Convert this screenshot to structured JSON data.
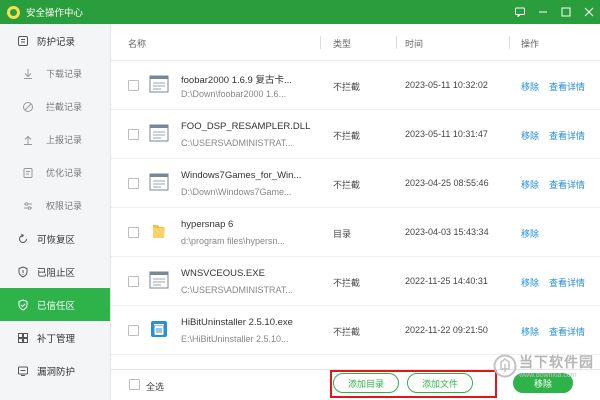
{
  "window": {
    "title": "安全操作中心"
  },
  "sidebar": {
    "items": [
      {
        "label": "防护记录",
        "icon": "shield-list-icon",
        "level": "top"
      },
      {
        "label": "下载记录",
        "icon": "download-icon",
        "level": "sub"
      },
      {
        "label": "拦截记录",
        "icon": "block-icon",
        "level": "sub"
      },
      {
        "label": "上报记录",
        "icon": "upload-icon",
        "level": "sub"
      },
      {
        "label": "优化记录",
        "icon": "optimize-icon",
        "level": "sub"
      },
      {
        "label": "权限记录",
        "icon": "permission-icon",
        "level": "sub"
      },
      {
        "label": "可恢复区",
        "icon": "restore-icon",
        "level": "top"
      },
      {
        "label": "已阻止区",
        "icon": "blocked-shield-icon",
        "level": "top"
      },
      {
        "label": "已信任区",
        "icon": "trusted-shield-icon",
        "level": "top",
        "active": true
      },
      {
        "label": "补丁管理",
        "icon": "patch-icon",
        "level": "top"
      },
      {
        "label": "漏洞防护",
        "icon": "vulnerability-icon",
        "level": "top"
      }
    ]
  },
  "table": {
    "headers": {
      "name": "名称",
      "type": "类型",
      "time": "时间",
      "action": "操作"
    },
    "rows": [
      {
        "name": "foobar2000  1.6.9 复古卡...",
        "path": "D:\\Down\\foobar2000  1.6...",
        "type": "不拦截",
        "time": "2023-05-11 10:32:02",
        "icon": "window-icon",
        "actions": [
          "移除",
          "查看详情"
        ]
      },
      {
        "name": "FOO_DSP_RESAMPLER.DLL",
        "path": "C:\\USERS\\ADMINISTRAT...",
        "type": "不拦截",
        "time": "2023-05-11 10:31:47",
        "icon": "window-icon",
        "actions": [
          "移除",
          "查看详情"
        ]
      },
      {
        "name": "Windows7Games_for_Win...",
        "path": "D:\\Down\\Windows7Game...",
        "type": "不拦截",
        "time": "2023-04-25 08:55:46",
        "icon": "window-icon",
        "actions": [
          "移除",
          "查看详情"
        ]
      },
      {
        "name": "hypersnap 6",
        "path": "d:\\program files\\hypersn...",
        "type": "目录",
        "time": "2023-04-03 15:43:34",
        "icon": "folder-icon",
        "actions": [
          "移除"
        ]
      },
      {
        "name": "WNSVCEOUS.EXE",
        "path": "C:\\USERS\\ADMINISTRAT...",
        "type": "不拦截",
        "time": "2022-11-25 14:40:31",
        "icon": "window-icon",
        "actions": [
          "移除",
          "查看详情"
        ]
      },
      {
        "name": "HiBitUninstaller 2.5.10.exe",
        "path": "E:\\HiBitUninstaller 2.5.10...",
        "type": "不拦截",
        "time": "2022-11-22 09:21:50",
        "icon": "uninstaller-icon",
        "actions": [
          "移除",
          "查看详情"
        ]
      }
    ]
  },
  "footer": {
    "select_all": "全选",
    "add_dir": "添加目录",
    "add_file": "添加文件",
    "remove": "移除"
  },
  "watermark": {
    "text": "当下软件园",
    "url": "www.downxia.com"
  },
  "colors": {
    "titlebar": "#2a9d3d",
    "accent": "#2eb34a",
    "link": "#1f8de0",
    "highlight": "#e3161c"
  }
}
